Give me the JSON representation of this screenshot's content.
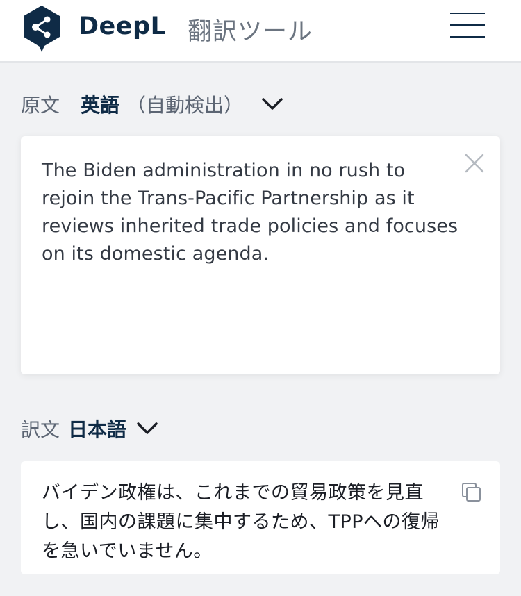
{
  "header": {
    "brand": "DeepL",
    "title": "翻訳ツール",
    "logo_icon": "deepl-logo-icon",
    "menu_icon": "hamburger-menu-icon"
  },
  "source": {
    "label": "原文",
    "language": "英語",
    "detect": "（自動検出）",
    "text": "The Biden administration in no rush to rejoin the Trans-Pacific Partnership as it reviews inherited trade policies and focuses on its domestic agenda.",
    "clear_icon": "close-icon"
  },
  "target": {
    "label": "訳文",
    "language": "日本語",
    "text": "バイデン政権は、これまでの貿易政策を見直し、国内の課題に集中するため、TPPへの復帰を急いでいません。",
    "copy_icon": "copy-icon"
  },
  "colors": {
    "brand_navy": "#0f2b46",
    "background": "#f1f2f4",
    "panel": "#ffffff",
    "muted_text": "#5c6573"
  }
}
